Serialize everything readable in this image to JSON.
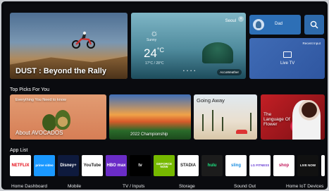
{
  "hero": {
    "title": "DUST : Beyond the Rally"
  },
  "weather": {
    "city": "Seoul",
    "condition": "Sunny",
    "temperature": "24",
    "unit": "°C",
    "range": "17°C / 28°C",
    "close_glyph": "×",
    "dots": "• • • •",
    "badge": "AccuWeather"
  },
  "user": {
    "name": "Dad"
  },
  "live_tv": {
    "top_label": "Recent Input",
    "label": "Live TV"
  },
  "sections": {
    "top_picks": "Top Picks For You",
    "app_list": "App List"
  },
  "picks": [
    {
      "top": "Everything You Need to know",
      "bottom": "About AVOCADOS"
    },
    {
      "caption": "2022 Championship"
    },
    {
      "caption": "Going Away"
    },
    {
      "caption": "The Language Of Flower"
    }
  ],
  "apps": [
    {
      "label": "NETFLIX",
      "bg": "#ffffff",
      "fg": "#e50914"
    },
    {
      "label": "prime video",
      "bg": "#1a98ff",
      "fg": "#ffffff"
    },
    {
      "label": "Disney+",
      "bg": "#0e1a3d",
      "fg": "#ffffff"
    },
    {
      "label": "YouTube",
      "bg": "#ffffff",
      "fg": "#222222"
    },
    {
      "label": "HBO max",
      "bg": "#6a2cc7",
      "fg": "#ffffff"
    },
    {
      "label": "tv",
      "bg": "#000000",
      "fg": "#ffffff"
    },
    {
      "label": "GEFORCE NOW",
      "bg": "#76b900",
      "fg": "#ffffff"
    },
    {
      "label": "STADIA",
      "bg": "#ffffff",
      "fg": "#222222"
    },
    {
      "label": "hulu",
      "bg": "#1c1c1c",
      "fg": "#1ce783"
    },
    {
      "label": "sling",
      "bg": "#ffffff",
      "fg": "#1a8de0"
    },
    {
      "label": "LG FITNESS",
      "bg": "#ffffff",
      "fg": "#6a3fd4"
    },
    {
      "label": "shop",
      "bg": "#ffffff",
      "fg": "#c2185b"
    },
    {
      "label": "LIVE NOW",
      "bg": "#111111",
      "fg": "#ffffff"
    },
    {
      "label": "",
      "bg": "#ffffff",
      "fg": "#222222"
    }
  ],
  "bottom_nav": [
    "Home Dashboard",
    "Mobile",
    "TV / Inputs",
    "Storage",
    "Sound Out",
    "Home IoT Devices"
  ]
}
